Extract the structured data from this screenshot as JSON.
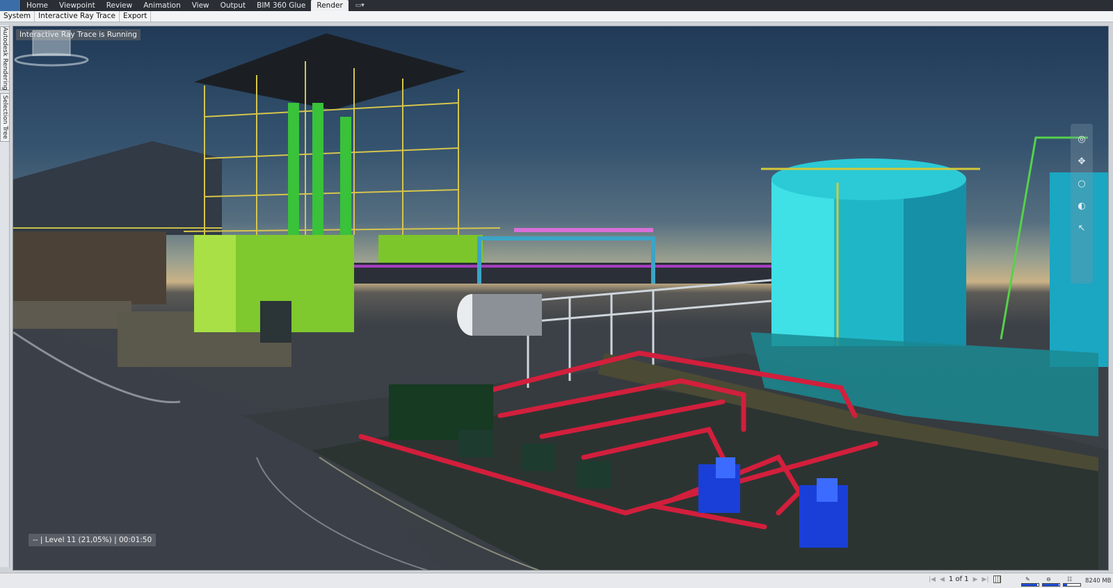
{
  "ribbon": {
    "tabs": [
      {
        "label": "Home"
      },
      {
        "label": "Viewpoint"
      },
      {
        "label": "Review"
      },
      {
        "label": "Animation"
      },
      {
        "label": "View"
      },
      {
        "label": "Output"
      },
      {
        "label": "BIM 360 Glue"
      },
      {
        "label": "Render",
        "active": true
      }
    ]
  },
  "subtabs": [
    {
      "label": "System"
    },
    {
      "label": "Interactive Ray Trace"
    },
    {
      "label": "Export"
    }
  ],
  "dock": {
    "autodesk_rendering": "Autodesk Rendering",
    "selection_tree": "Selection Tree"
  },
  "viewport": {
    "status": "Interactive Ray Trace is Running",
    "progress": "-- | Level 11 (21,05%) | 00:01:50"
  },
  "statusbar": {
    "page": "1 of 1",
    "memory": "8240 MB",
    "perf_levels": [
      0.9,
      0.95,
      0.2
    ]
  },
  "colors": {
    "ribbon_bg": "#2b2f35",
    "active_tab": "#eef0f2",
    "perf_fill": "#1f4fd6"
  }
}
